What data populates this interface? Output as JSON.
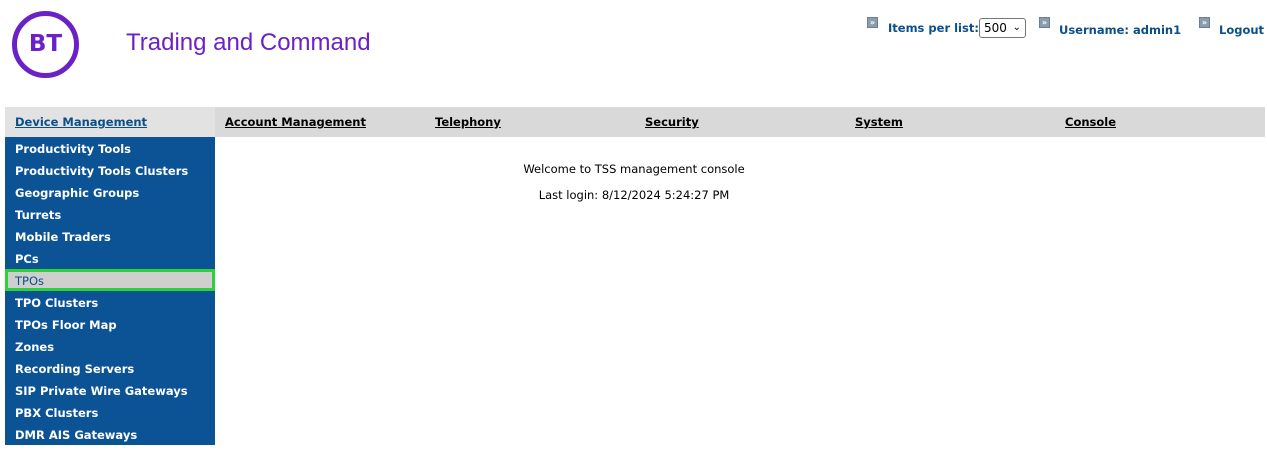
{
  "brand": {
    "logo_text": "BT",
    "app_title": "Trading and Command"
  },
  "header": {
    "items_per_list_label": "Items per list:",
    "items_per_list_value": "500",
    "username": "Username: admin1",
    "logout_label": "Logout"
  },
  "nav": {
    "tabs": [
      {
        "label": "Device Management",
        "active": true
      },
      {
        "label": "Account Management",
        "active": false
      },
      {
        "label": "Telephony",
        "active": false
      },
      {
        "label": "Security",
        "active": false
      },
      {
        "label": "System",
        "active": false
      },
      {
        "label": "Console",
        "active": false
      }
    ]
  },
  "sidebar": {
    "items": [
      {
        "label": "Productivity Tools"
      },
      {
        "label": "Productivity Tools Clusters"
      },
      {
        "label": "Geographic Groups"
      },
      {
        "label": "Turrets"
      },
      {
        "label": "Mobile Traders"
      },
      {
        "label": "PCs"
      },
      {
        "label": "TPOs",
        "selected": true
      },
      {
        "label": "TPO Clusters"
      },
      {
        "label": "TPOs Floor Map"
      },
      {
        "label": "Zones"
      },
      {
        "label": "Recording Servers"
      },
      {
        "label": "SIP Private Wire Gateways"
      },
      {
        "label": "PBX Clusters"
      },
      {
        "label": "DMR AIS Gateways"
      }
    ]
  },
  "main": {
    "welcome": "Welcome to TSS management console",
    "last_login": "Last login: 8/12/2024 5:24:27 PM"
  },
  "colors": {
    "brand_purple": "#6a22c8",
    "sidebar_blue": "#0b5394",
    "link_blue": "#0b4f8a",
    "highlight_green": "#2ed13a"
  }
}
